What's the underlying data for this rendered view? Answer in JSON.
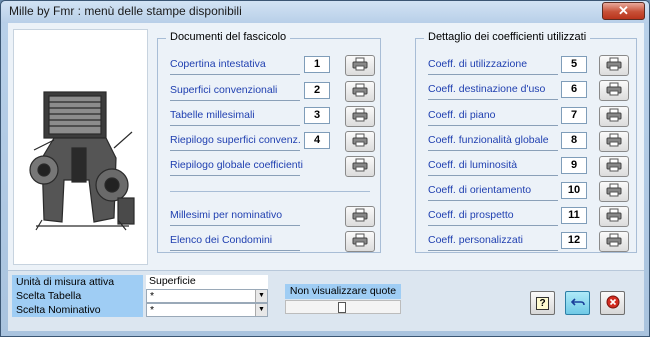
{
  "window": {
    "title": "Mille by Fmr : menù delle stampe disponibili",
    "close_label": "✕"
  },
  "documents": {
    "title": "Documenti del fascicolo",
    "items": [
      {
        "label": "Copertina intestativa",
        "num": "1"
      },
      {
        "label": "Superfici convenzionali",
        "num": "2"
      },
      {
        "label": "Tabelle millesimali",
        "num": "3"
      },
      {
        "label": "Riepilogo superfici convenz.",
        "num": "4"
      },
      {
        "label": "Riepilogo globale coefficienti",
        "num": ""
      },
      {
        "label": "Millesimi per nominativo",
        "num": ""
      },
      {
        "label": "Elenco dei Condomini",
        "num": ""
      }
    ]
  },
  "coefficients": {
    "title": "Dettaglio dei coefficienti utilizzati",
    "items": [
      {
        "label": "Coeff. di utilizzazione",
        "num": "5"
      },
      {
        "label": "Coeff. destinazione d'uso",
        "num": "6"
      },
      {
        "label": "Coeff. di piano",
        "num": "7"
      },
      {
        "label": "Coeff. funzionalità globale",
        "num": "8"
      },
      {
        "label": "Coeff. di luminosità",
        "num": "9"
      },
      {
        "label": "Coeff. di orientamento",
        "num": "10"
      },
      {
        "label": "Coeff. di prospetto",
        "num": "11"
      },
      {
        "label": "Coeff. personalizzati",
        "num": "12"
      }
    ]
  },
  "filters": {
    "unit_label": "Unità di misura attiva",
    "unit_value": "Superficie",
    "table_label": "Scelta Tabella",
    "table_value": "*",
    "nominative_label": "Scelta Nominativo",
    "nominative_value": "*"
  },
  "quote": {
    "label": "Non visualizzare quote",
    "slider_value": 0.5
  },
  "actions": {
    "help_label": "?"
  },
  "icons": {
    "print": "printer-icon",
    "help": "help-icon",
    "undo": "undo-icon",
    "cancel": "cancel-icon"
  }
}
